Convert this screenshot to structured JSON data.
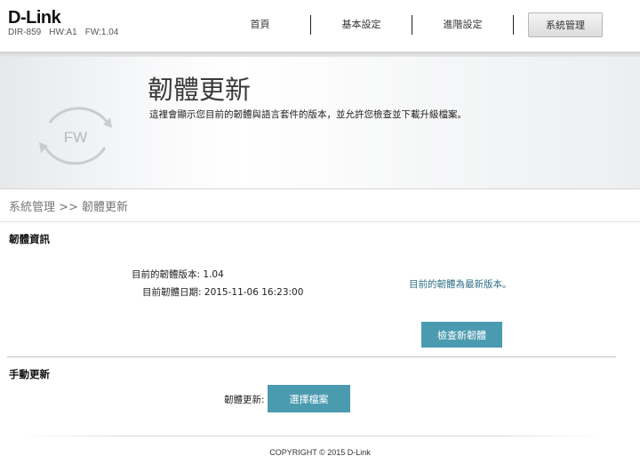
{
  "brand": {
    "logo": "D-Link",
    "model": "DIR-859",
    "hw": "HW:A1",
    "fw": "FW:1.04"
  },
  "nav": {
    "items": [
      "首頁",
      "基本設定",
      "進階設定",
      "系統管理"
    ],
    "active": "系統管理"
  },
  "banner": {
    "icon_text": "FW",
    "title": "韌體更新",
    "description": "這裡會顯示您目前的韌體與語言套件的版本，並允許您檢查並下載升級檔案。"
  },
  "breadcrumb": "系統管理 >> 韌體更新",
  "firmware_info": {
    "section_title": "韌體資訊",
    "version_label": "目前的韌體版本:",
    "version_value": "1.04",
    "date_label": "目前韌體日期:",
    "date_value": "2015-11-06 16:23:00",
    "status": "目前的韌體為最新版本。",
    "check_button": "檢查新韌體"
  },
  "manual_update": {
    "section_title": "手動更新",
    "label": "韌體更新:",
    "select_button": "選擇檔案"
  },
  "footer": "COPYRIGHT © 2015 D-Link",
  "colors": {
    "accent_button": "#4b9bb0",
    "status_text": "#2d6f86"
  }
}
